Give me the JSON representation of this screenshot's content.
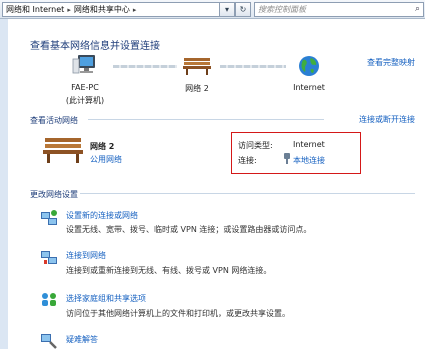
{
  "address_bar": {
    "crumbs": [
      "网络和 Internet",
      "网络和共享中心"
    ],
    "search_placeholder": "搜索控制面板"
  },
  "header": {
    "title": "查看基本网络信息并设置连接",
    "full_map_link": "查看完整映射"
  },
  "network_map": {
    "computer": {
      "name": "FAE-PC",
      "subtitle": "(此计算机)"
    },
    "network": {
      "name": "网络  2"
    },
    "internet": {
      "name": "Internet"
    }
  },
  "active_networks": {
    "heading": "查看活动网络",
    "connect_link": "连接或断开连接",
    "network": {
      "name": "网络  2",
      "category": "公用网络"
    },
    "access_type_label": "访问类型:",
    "access_type_value": "Internet",
    "connection_label": "连接:",
    "connection_value": "本地连接"
  },
  "change_settings": {
    "heading": "更改网络设置",
    "tasks": [
      {
        "title": "设置新的连接或网络",
        "desc": "设置无线、宽带、拨号、临时或 VPN 连接；或设置路由器或访问点。"
      },
      {
        "title": "连接到网络",
        "desc": "连接到或重新连接到无线、有线、拨号或 VPN 网络连接。"
      },
      {
        "title": "选择家庭组和共享选项",
        "desc": "访问位于其他网络计算机上的文件和打印机，或更改共享设置。"
      },
      {
        "title": "疑难解答",
        "desc": ""
      }
    ]
  }
}
